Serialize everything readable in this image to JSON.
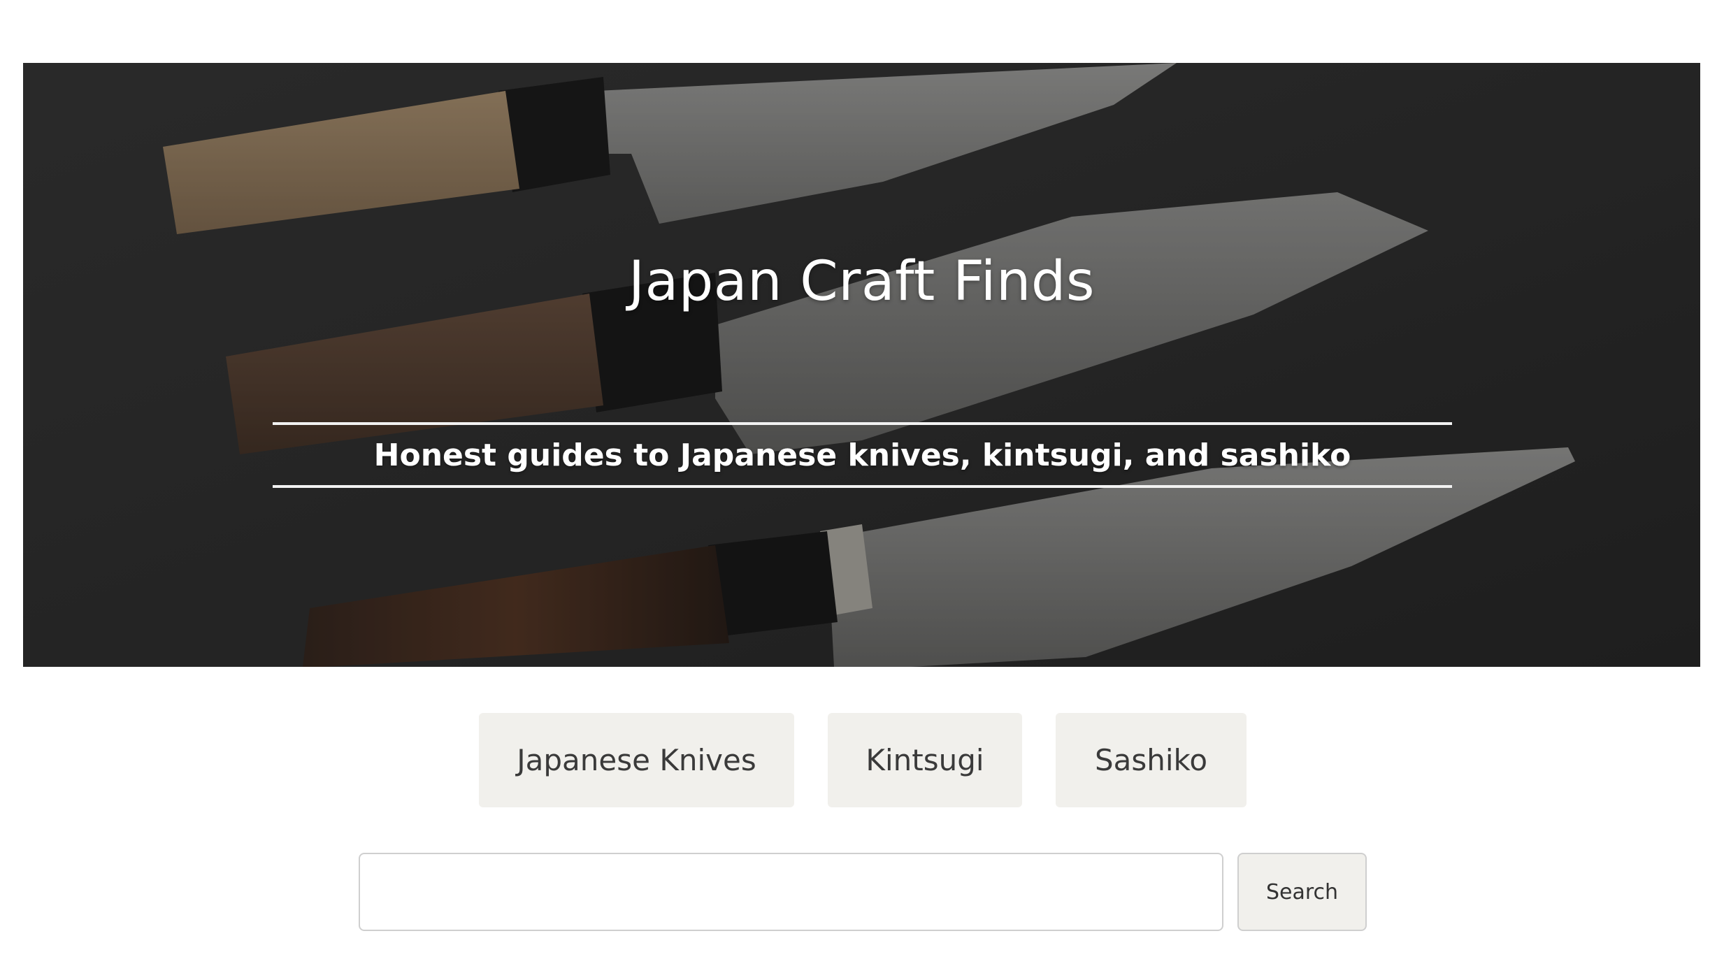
{
  "hero": {
    "title": "Japan Craft Finds",
    "tagline": "Honest guides to Japanese knives, kintsugi, and sashiko",
    "image": "japanese-knives-on-slate-photo"
  },
  "categories": [
    {
      "label": "Japanese Knives"
    },
    {
      "label": "Kintsugi"
    },
    {
      "label": "Sashiko"
    }
  ],
  "search": {
    "value": "",
    "placeholder": "",
    "button_label": "Search"
  },
  "colors": {
    "button_bg": "#f1f0ec",
    "button_text": "#3a3a3a",
    "hero_text": "#ffffff",
    "input_border": "#cfcfcf"
  }
}
